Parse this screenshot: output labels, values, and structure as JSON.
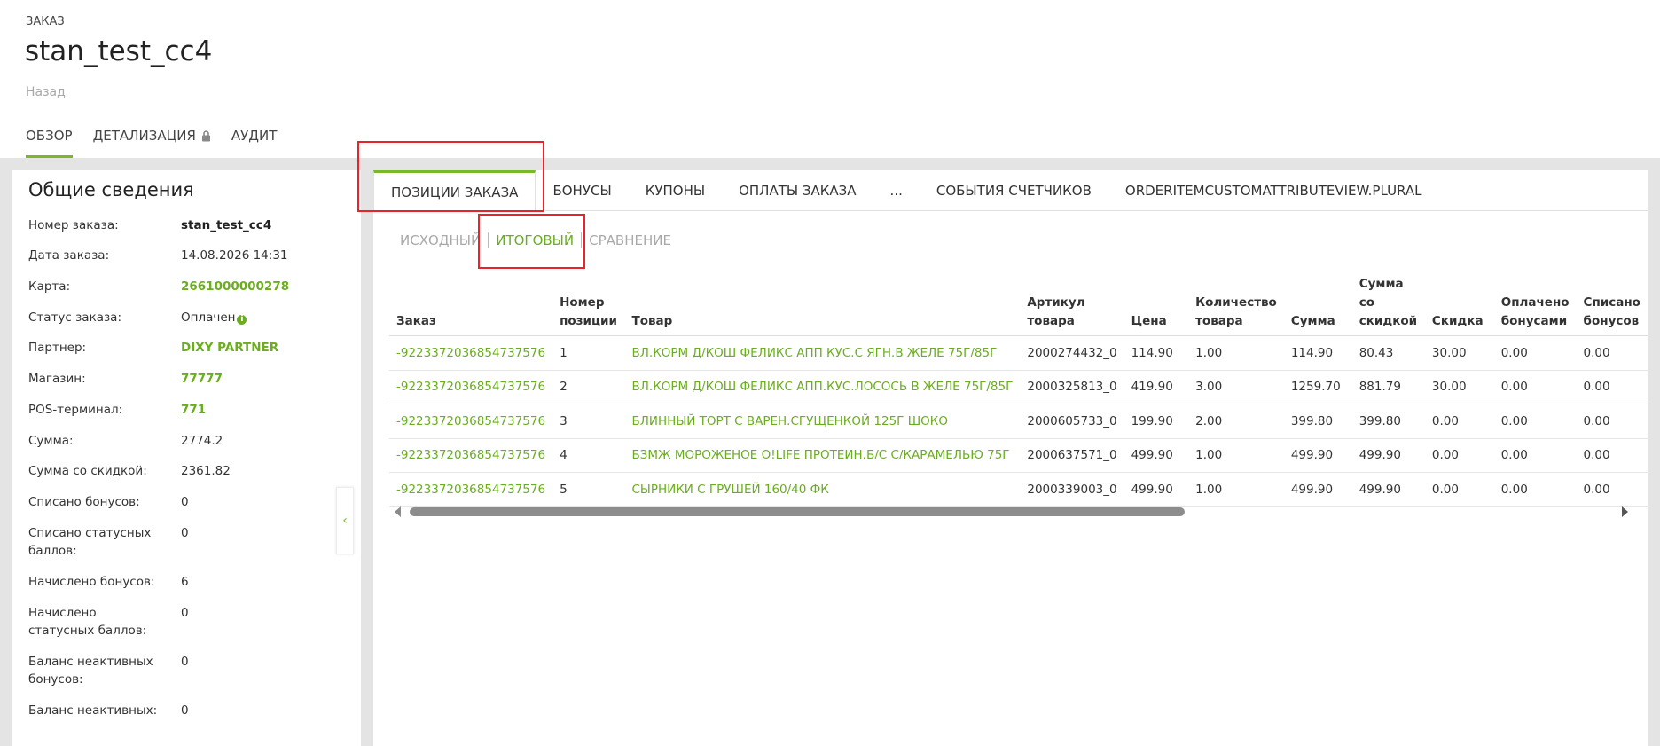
{
  "header": {
    "kicker": "ЗАКАЗ",
    "title": "stan_test_cc4",
    "back": "Назад",
    "tabs": [
      {
        "label": "ОБЗОР"
      },
      {
        "label": "ДЕТАЛИЗАЦИЯ"
      },
      {
        "label": "АУДИТ"
      }
    ],
    "active_tab": "ОБЗОР"
  },
  "overview": {
    "title": "Общие сведения",
    "rows": [
      {
        "label": "Номер заказа:",
        "value": "stan_test_cc4"
      },
      {
        "label": "Дата заказа:",
        "value": "14.08.2026 14:31"
      },
      {
        "label": "Карта:",
        "value": "2661000000278"
      },
      {
        "label": "Статус заказа:",
        "value": "Оплачен"
      },
      {
        "label": "Партнер:",
        "value": "DIXY PARTNER"
      },
      {
        "label": "Магазин:",
        "value": "77777"
      },
      {
        "label": "POS-терминал:",
        "value": "771"
      },
      {
        "label": "Сумма:",
        "value": "2774.2"
      },
      {
        "label": "Сумма со скидкой:",
        "value": "2361.82"
      },
      {
        "label": "Списано бонусов:",
        "value": "0"
      },
      {
        "label": "Списано статусных баллов:",
        "value": "0"
      },
      {
        "label": "Начислено бонусов:",
        "value": "6"
      },
      {
        "label": "Начислено статусных баллов:",
        "value": "0"
      },
      {
        "label": "Баланс неактивных бонусов:",
        "value": "0"
      },
      {
        "label": "Баланс неактивных:",
        "value": "0"
      }
    ],
    "status_icon": "info-icon"
  },
  "main_tabs": [
    {
      "label": "ПОЗИЦИИ ЗАКАЗА"
    },
    {
      "label": "БОНУСЫ"
    },
    {
      "label": "КУПОНЫ"
    },
    {
      "label": "ОПЛАТЫ ЗАКАЗА"
    },
    {
      "label": "..."
    },
    {
      "label": "СОБЫТИЯ СЧЕТЧИКОВ"
    },
    {
      "label": "ORDERITEMCUSTOMATTRIBUTEVIEW.PLURAL"
    }
  ],
  "sub_tabs": [
    {
      "label": "ИСХОДНЫЙ"
    },
    {
      "label": "ИТОГОВЫЙ"
    },
    {
      "label": "СРАВНЕНИЕ"
    }
  ],
  "table": {
    "columns": [
      {
        "line1": "",
        "line2": "",
        "line3": "Заказ"
      },
      {
        "line1": "",
        "line2": "Номер",
        "line3": "позиции"
      },
      {
        "line1": "",
        "line2": "",
        "line3": "Товар"
      },
      {
        "line1": "",
        "line2": "Артикул",
        "line3": "товара"
      },
      {
        "line1": "",
        "line2": "",
        "line3": "Цена"
      },
      {
        "line1": "",
        "line2": "Количество",
        "line3": "товара"
      },
      {
        "line1": "",
        "line2": "",
        "line3": "Сумма"
      },
      {
        "line1": "Сумма",
        "line2": "со",
        "line3": "скидкой"
      },
      {
        "line1": "",
        "line2": "",
        "line3": "Скидка"
      },
      {
        "line1": "",
        "line2": "Оплачено",
        "line3": "бонусами"
      },
      {
        "line1": "",
        "line2": "Списано",
        "line3": "бонусов"
      }
    ],
    "rows": [
      [
        "-9223372036854737576",
        "1",
        "ВЛ.КОРМ Д/КОШ ФЕЛИКС АПП КУС.С ЯГН.В ЖЕЛЕ 75Г/85Г",
        "2000274432_0",
        "114.90",
        "1.00",
        "114.90",
        "80.43",
        "30.00",
        "0.00",
        "0.00"
      ],
      [
        "-9223372036854737576",
        "2",
        "ВЛ.КОРМ Д/КОШ ФЕЛИКС АПП.КУС.ЛОСОСЬ В ЖЕЛЕ 75Г/85Г",
        "2000325813_0",
        "419.90",
        "3.00",
        "1259.70",
        "881.79",
        "30.00",
        "0.00",
        "0.00"
      ],
      [
        "-9223372036854737576",
        "3",
        "БЛИННЫЙ ТОРТ С ВАРЕН.СГУЩЕНКОЙ 125Г ШОКО",
        "2000605733_0",
        "199.90",
        "2.00",
        "399.80",
        "399.80",
        "0.00",
        "0.00",
        "0.00"
      ],
      [
        "-9223372036854737576",
        "4",
        "БЗМЖ МОРОЖЕНОЕ O!LIFE ПРОТЕИН.Б/С С/КАРАМЕЛЬЮ 75Г",
        "2000637571_0",
        "499.90",
        "1.00",
        "499.90",
        "499.90",
        "0.00",
        "0.00",
        "0.00"
      ],
      [
        "-9223372036854737576",
        "5",
        "СЫРНИКИ С ГРУШЕЙ 160/40 ФК",
        "2000339003_0",
        "499.90",
        "1.00",
        "499.90",
        "499.90",
        "0.00",
        "0.00",
        "0.00"
      ]
    ]
  },
  "colors": {
    "accent": "#7ab82b",
    "link": "#6aad1f",
    "annotation": "#e8232a",
    "background": "#e4e4e4"
  }
}
